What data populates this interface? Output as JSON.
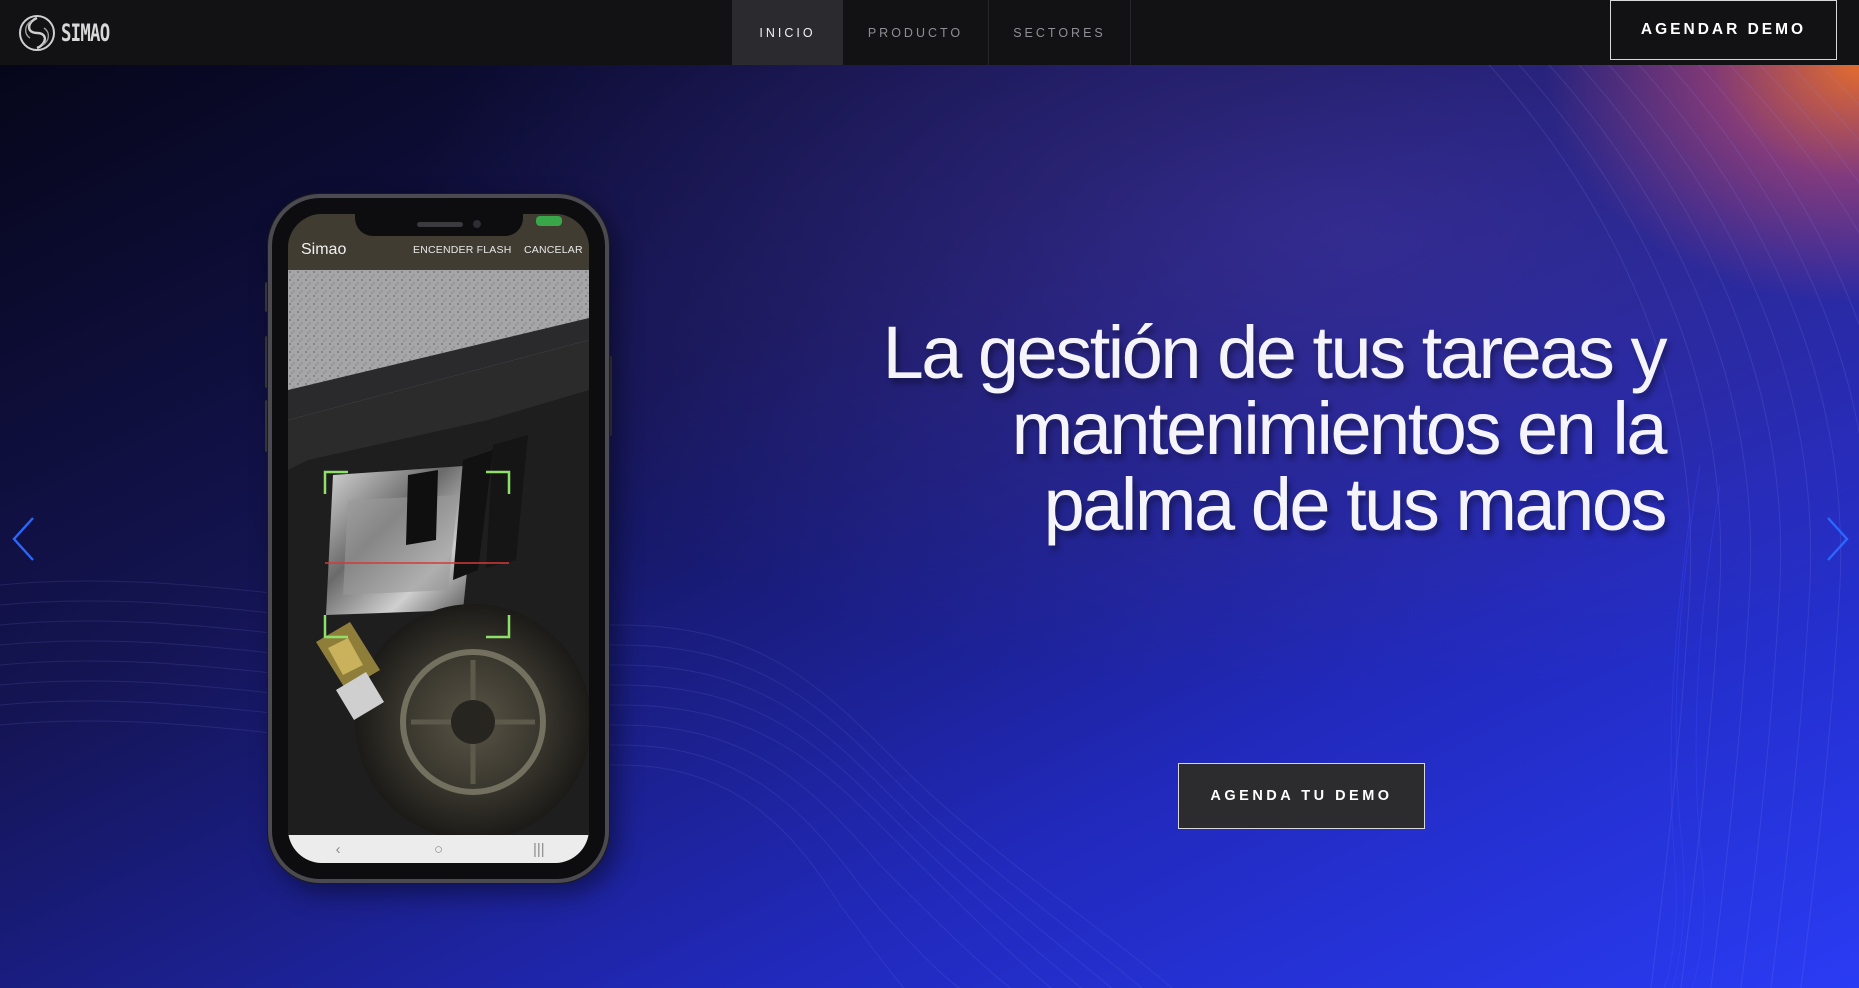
{
  "header": {
    "logo_text": "SIMAO",
    "nav": [
      {
        "label": "INICIO",
        "active": true
      },
      {
        "label": "PRODUCTO",
        "active": false
      },
      {
        "label": "SECTORES",
        "active": false
      }
    ],
    "cta_label": "AGENDAR DEMO"
  },
  "hero": {
    "headline_lines": [
      "La gestión de tus tareas y",
      "mantenimientos en la",
      "palma de tus manos"
    ],
    "cta_label": "AGENDA TU DEMO",
    "prev_icon": "chevron-left-icon",
    "next_icon": "chevron-right-icon"
  },
  "phone": {
    "app_title": "Simao",
    "flash_label": "ENCENDER FLASH",
    "cancel_label": "CANCELAR",
    "nav_back": "‹",
    "nav_home": "○",
    "nav_recent": "|||"
  },
  "colors": {
    "header_bg": "#121214",
    "hero_dark": "#0b0b24",
    "hero_blue": "#2236e6",
    "hero_orange": "#ec702a",
    "arrow_blue": "#2a67ff",
    "scan_frame_green": "#8fe06a"
  }
}
